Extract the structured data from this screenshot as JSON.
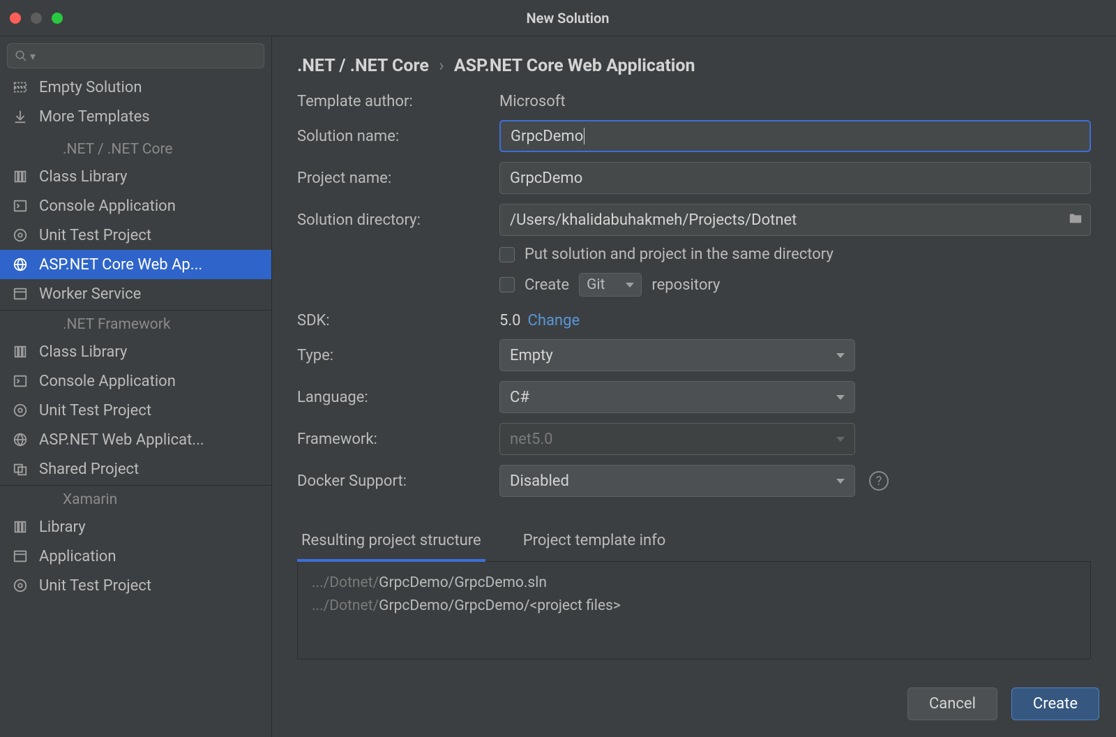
{
  "window": {
    "title": "New Solution"
  },
  "sidebar": {
    "top": [
      {
        "icon": "empty-solution-icon",
        "label": "Empty Solution"
      },
      {
        "icon": "download-icon",
        "label": "More Templates"
      }
    ],
    "groups": [
      {
        "heading": ".NET / .NET Core",
        "items": [
          {
            "icon": "library-icon",
            "label": "Class Library"
          },
          {
            "icon": "console-icon",
            "label": "Console Application"
          },
          {
            "icon": "test-icon",
            "label": "Unit Test Project"
          },
          {
            "icon": "globe-icon",
            "label": "ASP.NET Core Web Ap...",
            "selected": true
          },
          {
            "icon": "window-icon",
            "label": "Worker Service"
          }
        ]
      },
      {
        "heading": ".NET Framework",
        "items": [
          {
            "icon": "library-icon",
            "label": "Class Library"
          },
          {
            "icon": "console-icon",
            "label": "Console Application"
          },
          {
            "icon": "test-icon",
            "label": "Unit Test Project"
          },
          {
            "icon": "globe-icon",
            "label": "ASP.NET Web Applicat..."
          },
          {
            "icon": "shared-icon",
            "label": "Shared Project"
          }
        ]
      },
      {
        "heading": "Xamarin",
        "items": [
          {
            "icon": "library-icon",
            "label": "Library"
          },
          {
            "icon": "window-icon",
            "label": "Application"
          },
          {
            "icon": "test-icon",
            "label": "Unit Test Project"
          }
        ]
      }
    ]
  },
  "breadcrumb": {
    "part1": ".NET / .NET Core",
    "part2": "ASP.NET Core Web Application"
  },
  "form": {
    "template_author_label": "Template author:",
    "template_author": "Microsoft",
    "solution_name_label": "Solution name:",
    "solution_name": "GrpcDemo",
    "project_name_label": "Project name:",
    "project_name": "GrpcDemo",
    "solution_directory_label": "Solution directory:",
    "solution_directory": "/Users/khalidabuhakmeh/Projects/Dotnet",
    "put_same_dir_label": "Put solution and project in the same directory",
    "create_label": "Create",
    "git_label": "Git",
    "repository_label": "repository",
    "sdk_label": "SDK:",
    "sdk_value": "5.0",
    "sdk_change": "Change",
    "type_label": "Type:",
    "type_value": "Empty",
    "language_label": "Language:",
    "language_value": "C#",
    "framework_label": "Framework:",
    "framework_value": "net5.0",
    "docker_label": "Docker Support:",
    "docker_value": "Disabled"
  },
  "tabs": {
    "t1": "Resulting project structure",
    "t2": "Project template info"
  },
  "result": {
    "line1_dim": ".../Dotnet/",
    "line1_bright": "GrpcDemo/GrpcDemo.sln",
    "line2_dim": ".../Dotnet/",
    "line2_bright": "GrpcDemo/GrpcDemo/<project files>"
  },
  "footer": {
    "cancel": "Cancel",
    "create": "Create"
  }
}
